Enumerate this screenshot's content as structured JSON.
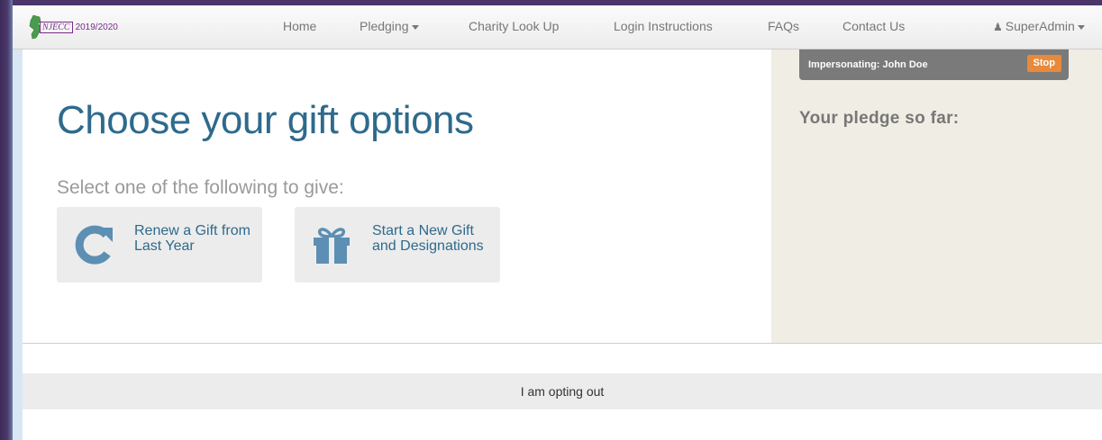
{
  "navbar": {
    "brand_abbr": "NJECC",
    "brand_year": "2019/2020",
    "items": [
      {
        "label": "Home"
      },
      {
        "label": "Pledging"
      },
      {
        "label": "Charity Look Up"
      },
      {
        "label": "Login Instructions"
      },
      {
        "label": "FAQs"
      },
      {
        "label": "Contact Us"
      }
    ],
    "user": "SuperAdmin"
  },
  "main": {
    "title": "Choose your gift options",
    "subtitle": "Select one of the following to give:",
    "options": [
      {
        "label": "Renew a Gift from Last Year",
        "icon": "refresh-icon"
      },
      {
        "label": "Start a New Gift and Designations",
        "icon": "gift-icon"
      }
    ]
  },
  "sidebar": {
    "impersonating": "Impersonating: John Doe",
    "stop_label": "Stop",
    "pledge_title": "Your pledge so far:"
  },
  "footer": {
    "opt_out_label": "I am opting out"
  },
  "colors": {
    "accent": "#2e6a8c",
    "icon": "#5c8fb3",
    "stop": "#e9893b",
    "sidebar_bg": "#f0ede4"
  }
}
